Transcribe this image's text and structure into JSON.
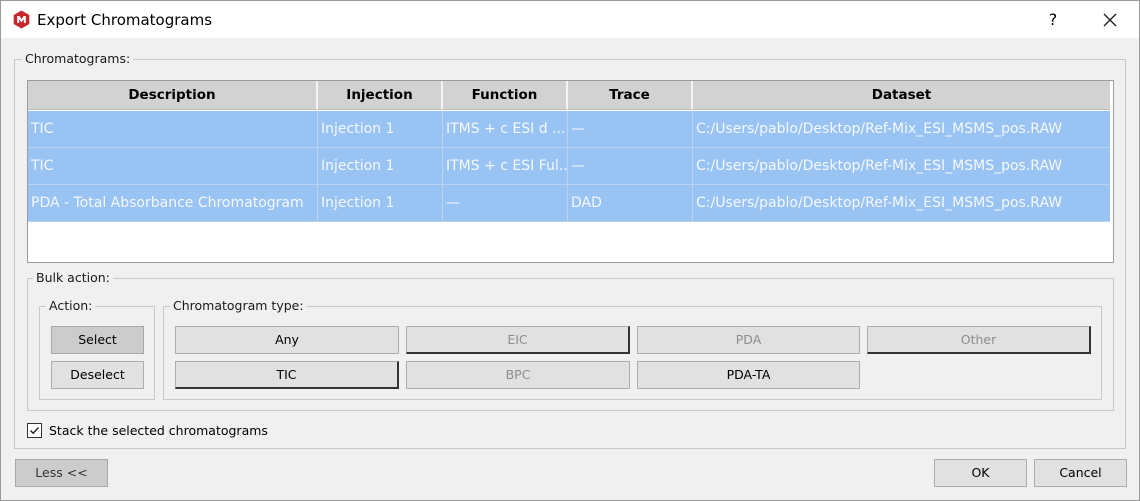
{
  "window": {
    "title": "Export Chromatograms",
    "help_label": "?"
  },
  "chromatograms": {
    "group_label": "Chromatograms:",
    "columns": [
      "Description",
      "Injection",
      "Function",
      "Trace",
      "Dataset"
    ],
    "rows": [
      [
        "TIC",
        "Injection 1",
        "ITMS + c ESI d ...",
        "—",
        "C:/Users/pablo/Desktop/Ref-Mix_ESI_MSMS_pos.RAW"
      ],
      [
        "TIC",
        "Injection 1",
        "ITMS + c ESI Ful...",
        "—",
        "C:/Users/pablo/Desktop/Ref-Mix_ESI_MSMS_pos.RAW"
      ],
      [
        "PDA - Total Absorbance Chromatogram",
        "Injection 1",
        "—",
        "DAD",
        "C:/Users/pablo/Desktop/Ref-Mix_ESI_MSMS_pos.RAW"
      ]
    ]
  },
  "bulk_action": {
    "group_label": "Bulk action:",
    "action_label": "Action:",
    "select_label": "Select",
    "deselect_label": "Deselect",
    "type_label": "Chromatogram type:",
    "types": {
      "any": "Any",
      "eic": "EIC",
      "pda": "PDA",
      "other": "Other",
      "tic": "TIC",
      "bpc": "BPC",
      "pda_ta": "PDA-TA"
    }
  },
  "stack": {
    "label": "Stack the selected chromatograms",
    "checked": true
  },
  "footer": {
    "less_label": "Less <<",
    "ok_label": "OK",
    "cancel_label": "Cancel"
  }
}
